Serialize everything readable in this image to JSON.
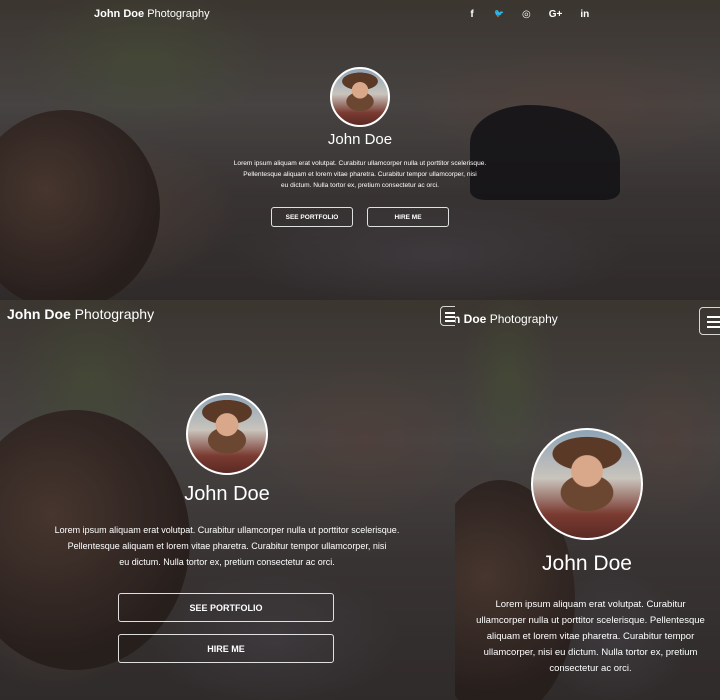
{
  "brand": {
    "bold": "John Doe",
    "light": "Photography"
  },
  "social": [
    {
      "icon": "facebook-icon",
      "glyph": "f"
    },
    {
      "icon": "twitter-icon",
      "glyph": "🐦"
    },
    {
      "icon": "instagram-icon",
      "glyph": "◎"
    },
    {
      "icon": "google-plus-icon",
      "glyph": "G+"
    },
    {
      "icon": "linkedin-icon",
      "glyph": "in"
    }
  ],
  "profile": {
    "name": "John Doe",
    "bio_line1": "Lorem ipsum aliquam erat volutpat. Curabitur ullamcorper nulla ut porttitor scelerisque.",
    "bio_line2": "Pellentesque aliquam et lorem vitae pharetra. Curabitur tempor ullamcorper, nisi",
    "bio_line3": "eu dictum. Nulla tortor ex, pretium consectetur ac orci."
  },
  "buttons": {
    "portfolio": "SEE PORTFOLIO",
    "hire": "HIRE ME"
  },
  "mobile": {
    "brand_bold": "n Doe",
    "bio": "Lorem ipsum aliquam erat volutpat. Curabitur ullamcorper nulla ut porttitor scelerisque. Pellentesque aliquam et lorem vitae pharetra. Curabitur tempor ullamcorper, nisi eu dictum. Nulla tortor ex, pretium consectetur ac orci."
  }
}
